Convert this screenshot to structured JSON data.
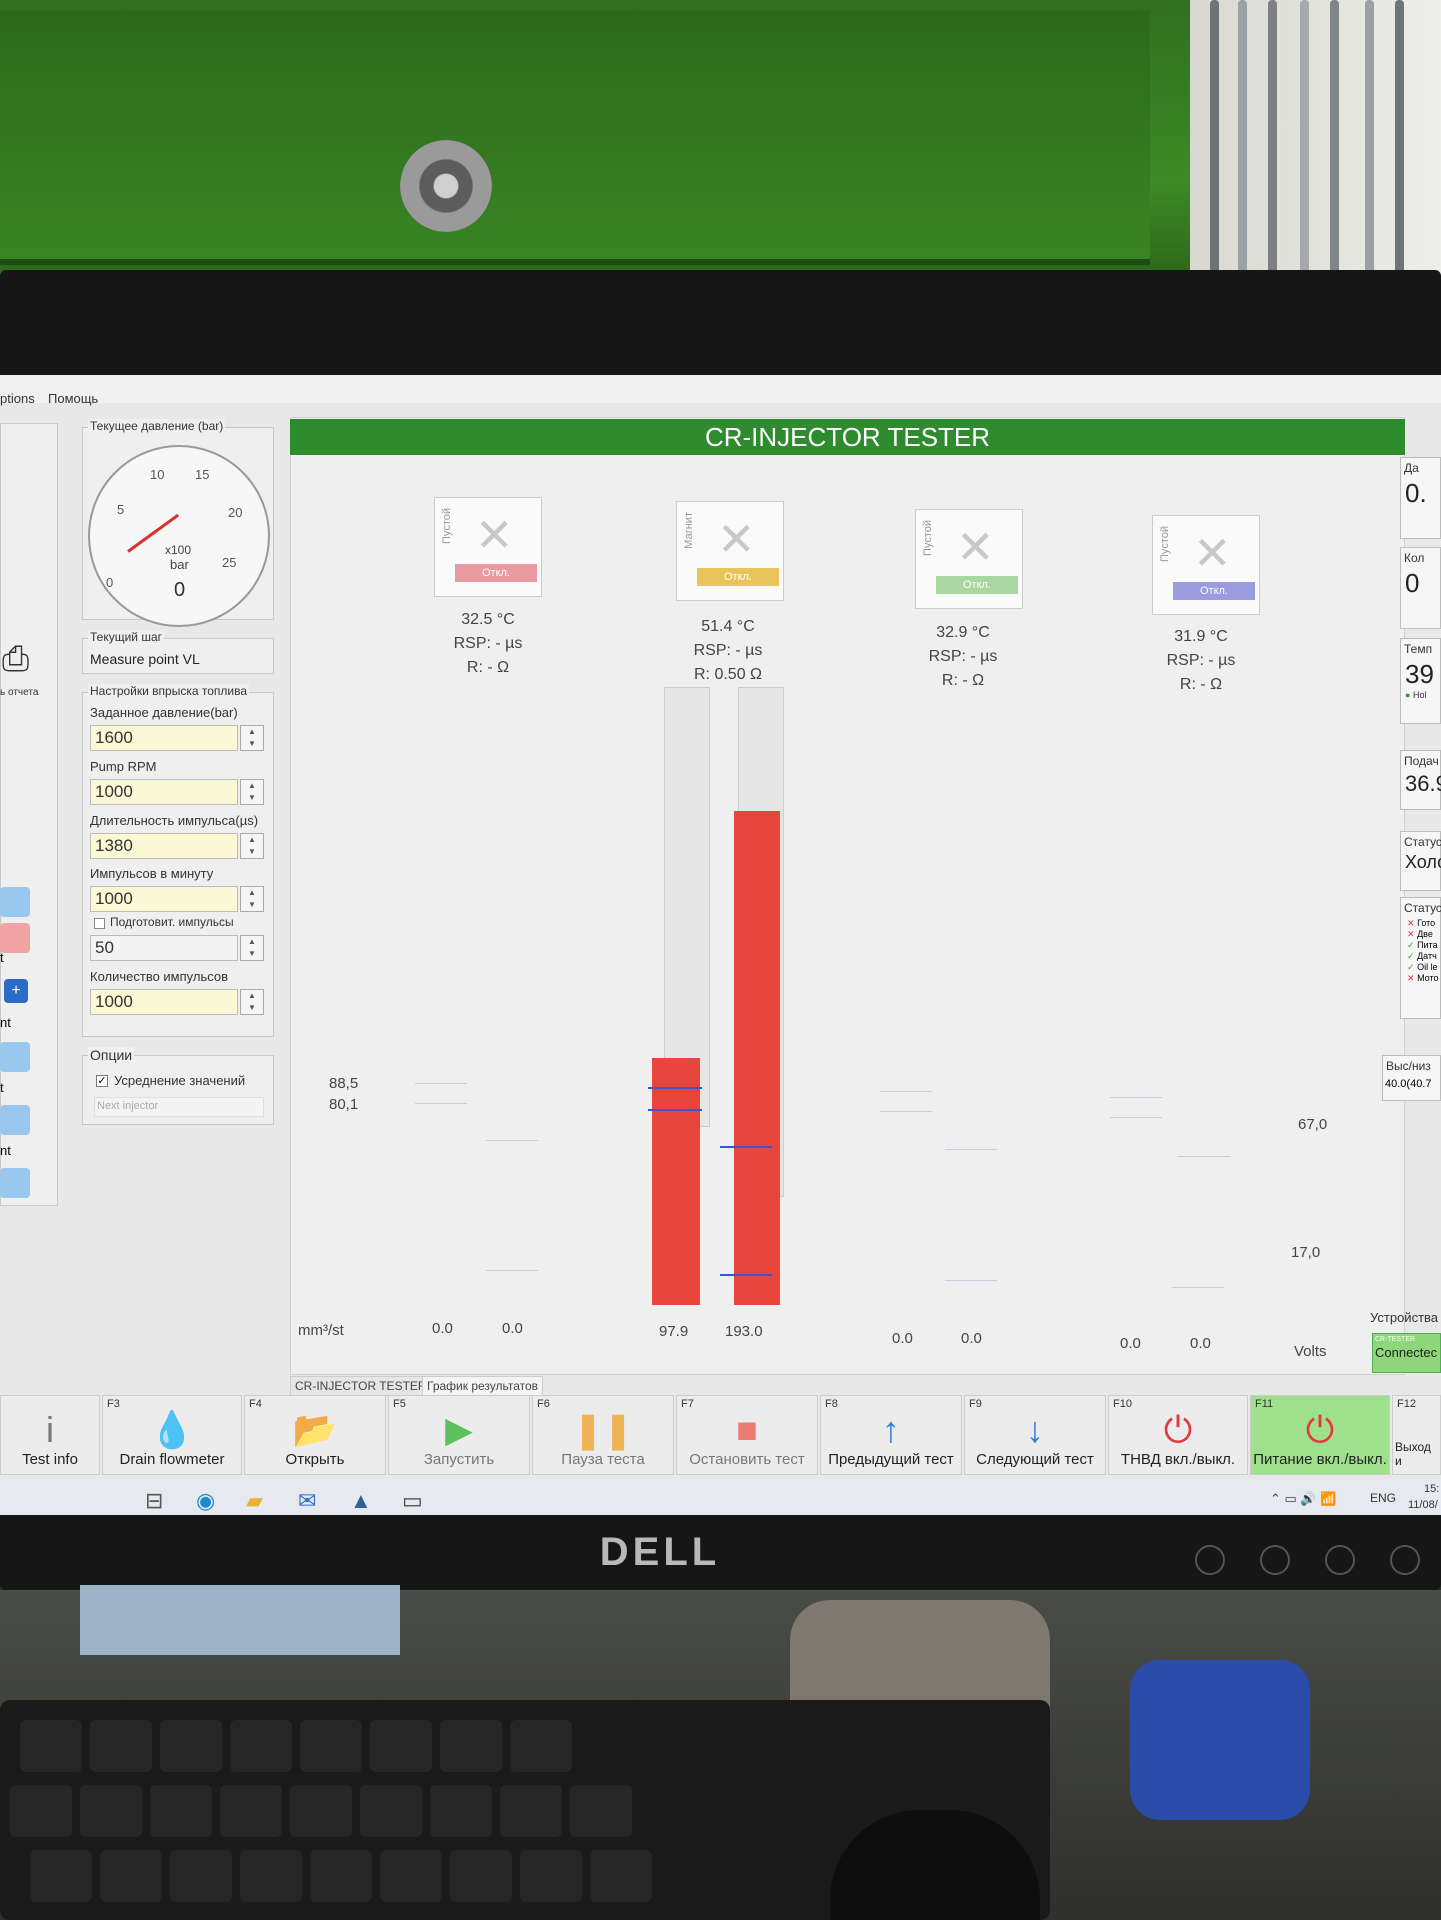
{
  "menu": {
    "options": "ptions",
    "help": "Помощь"
  },
  "pressure_gauge": {
    "group_title": "Текущее давление (bar)",
    "ticks": [
      "0",
      "5",
      "10",
      "15",
      "20",
      "25"
    ],
    "unit_multiplier": "x100",
    "unit": "bar",
    "value": "0"
  },
  "current_step": {
    "group_title": "Текущий шаг",
    "value": "Measure point VL"
  },
  "injection_settings": {
    "group_title": "Настройки впрыска топлива",
    "fields": [
      {
        "label": "Заданное давление(bar)",
        "value": "1600"
      },
      {
        "label": "Pump RPM",
        "value": "1000"
      },
      {
        "label": "Длительность импульса(µs)",
        "value": "1380"
      },
      {
        "label": "Импульсов в минуту",
        "value": "1000"
      }
    ],
    "pre_impulses": {
      "label": "Подготовит. импульсы",
      "checked": false,
      "value": "50"
    },
    "impulse_count": {
      "label": "Количество импульсов",
      "value": "1000"
    }
  },
  "options": {
    "group_title": "Опции",
    "averaging": {
      "label": "Усреднение значений",
      "checked": true
    },
    "next_injector": "Next injector"
  },
  "left_panel": {
    "print_label": "ь отчета",
    "partial_labels": [
      "t",
      "nt",
      "t",
      "nt"
    ]
  },
  "app_title": "CR-INJECTOR TESTER",
  "injectors": [
    {
      "type": "Пустой",
      "state": "Откл.",
      "state_color": "#e79a9f",
      "temp": "32.5 °C",
      "rsp": "RSP: - µs",
      "r": "R: - Ω",
      "values": [
        "0.0",
        "0.0"
      ]
    },
    {
      "type": "Магнит",
      "state": "Откл.",
      "state_color": "#e8c45a",
      "temp": "51.4 °C",
      "rsp": "RSP: - µs",
      "r": "R: 0.50 Ω",
      "values": [
        "97.9",
        "193.0"
      ],
      "fill_fractions": [
        0.4,
        0.8
      ]
    },
    {
      "type": "Пустой",
      "state": "Откл.",
      "state_color": "#a8d8a0",
      "temp": "32.9 °C",
      "rsp": "RSP: - µs",
      "r": "R: - Ω",
      "values": [
        "0.0",
        "0.0"
      ]
    },
    {
      "type": "Пустой",
      "state": "Откл.",
      "state_color": "#9b9be0",
      "temp": "31.9 °C",
      "rsp": "RSP: - µs",
      "r": "R: - Ω",
      "values": [
        "0.0",
        "0.0"
      ]
    }
  ],
  "axis": {
    "left_unit": "mm³/st",
    "left_marks": [
      "88,5",
      "80,1"
    ],
    "right_marks": [
      "67,0",
      "17,0"
    ],
    "right_unit": "Volts"
  },
  "bottom_tabs": [
    "CR-INJECTOR TESTER",
    "График результатов"
  ],
  "function_keys": [
    {
      "fn": "",
      "icon": "info-icon",
      "label": "Test info"
    },
    {
      "fn": "F3",
      "icon": "flowmeter-icon",
      "label": "Drain flowmeter"
    },
    {
      "fn": "F4",
      "icon": "folder-icon",
      "label": "Открыть"
    },
    {
      "fn": "F5",
      "icon": "play-icon",
      "label": "Запустить"
    },
    {
      "fn": "F6",
      "icon": "pause-icon",
      "label": "Пауза теста"
    },
    {
      "fn": "F7",
      "icon": "stop-icon",
      "label": "Остановить тест"
    },
    {
      "fn": "F8",
      "icon": "arrow-up-icon",
      "label": "Предыдущий тест"
    },
    {
      "fn": "F9",
      "icon": "arrow-down-icon",
      "label": "Следующий тест"
    },
    {
      "fn": "F10",
      "icon": "power-icon",
      "label": "ТНВД вкл./выкл."
    },
    {
      "fn": "F11",
      "icon": "power-icon",
      "label": "Питание вкл./выкл."
    },
    {
      "fn": "F12",
      "icon": "exit-icon",
      "label": "Выход и"
    }
  ],
  "right_panel": {
    "items": [
      {
        "label": "Да",
        "value": "0."
      },
      {
        "label": "Кол",
        "value": "0"
      },
      {
        "label": "Темп",
        "value": "39",
        "note": "Hol"
      },
      {
        "label": "Подач",
        "value": "36.9"
      },
      {
        "label": "Статус",
        "value": "Холо"
      }
    ],
    "status_group": {
      "title": "Статус",
      "rows": [
        {
          "ok": false,
          "text": "Гото"
        },
        {
          "ok": false,
          "text": "Две"
        },
        {
          "ok": true,
          "text": "Пита"
        },
        {
          "ok": true,
          "text": "Датч"
        },
        {
          "ok": true,
          "text": "Oil le"
        },
        {
          "ok": false,
          "text": "Мото"
        }
      ]
    },
    "hi_lo": {
      "label": "Выс/низ",
      "value": "40.0(40.7"
    },
    "devices": {
      "title": "Устройства",
      "tag": "CR-TESTER",
      "status": "Connectec"
    }
  },
  "taskbar": {
    "lang": "ENG",
    "time": "15:",
    "date": "11/08/"
  },
  "monitor": {
    "brand": "DELL"
  }
}
